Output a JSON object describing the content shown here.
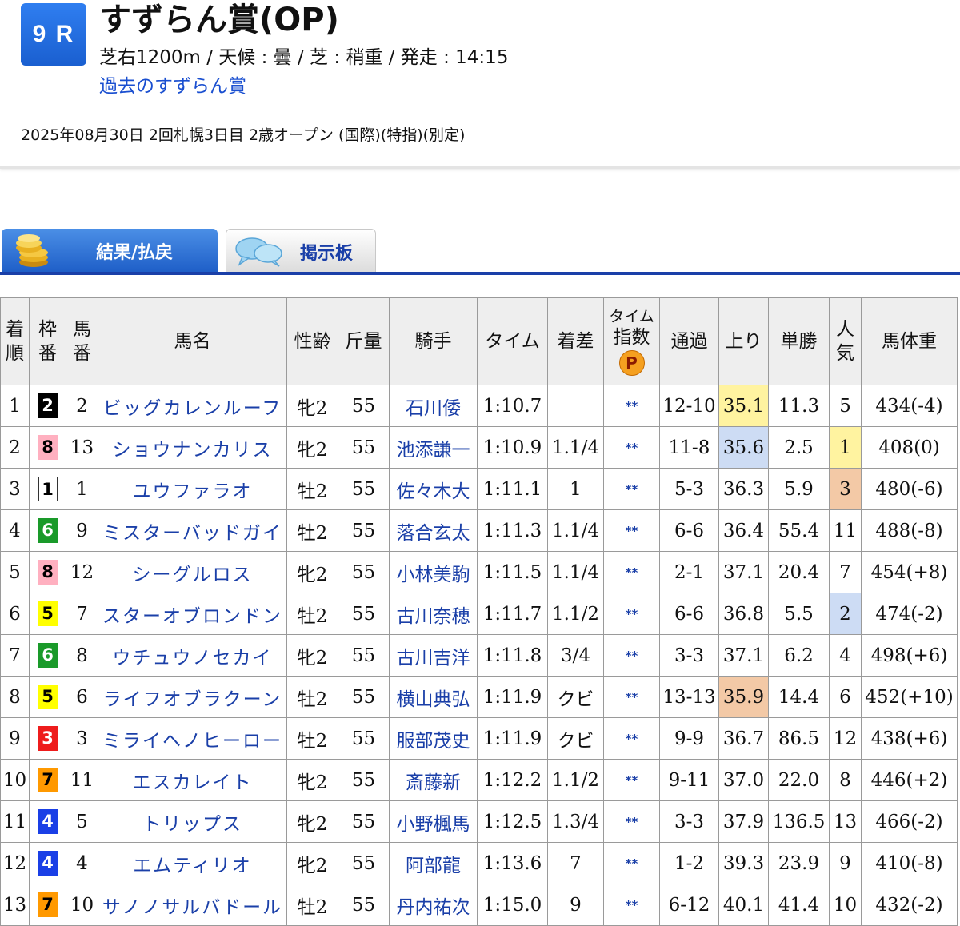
{
  "race": {
    "number": "9 R",
    "title": "すずらん賞(OP)",
    "info": "芝右1200m /  天候 : 曇 /  芝 : 稍重   /   発走 : 14:15",
    "past_link": "過去のすずらん賞",
    "date_line": "2025年08月30日 2回札幌3日目 2歳オープン  (国際)(特指)(別定)"
  },
  "tabs": {
    "results": "結果/払戻",
    "board": "掲示板"
  },
  "table": {
    "headers": {
      "rank": "着順",
      "waku": "枠番",
      "umaban": "馬番",
      "horse": "馬名",
      "sex_age": "性齢",
      "kinryo": "斤量",
      "jockey": "騎手",
      "time": "タイム",
      "margin": "着差",
      "time_index_top": "タイム",
      "time_index_bottom": "指数",
      "time_index_badge": "P",
      "passing": "通過",
      "last3f": "上り",
      "odds": "単勝",
      "popularity": "人気",
      "weight": "馬体重"
    },
    "rows": [
      {
        "rank": "1",
        "waku": "2",
        "umaban": "2",
        "horse": "ビッグカレンルーフ",
        "sex_age": "牝2",
        "kinryo": "55",
        "jockey": "石川倭",
        "time": "1:10.7",
        "margin": "",
        "index": "**",
        "passing": "12-10",
        "last3f": "35.1",
        "odds": "11.3",
        "pop": "5",
        "weight": "434(-4)"
      },
      {
        "rank": "2",
        "waku": "8",
        "umaban": "13",
        "horse": "ショウナンカリス",
        "sex_age": "牝2",
        "kinryo": "55",
        "jockey": "池添謙一",
        "time": "1:10.9",
        "margin": "1.1/4",
        "index": "**",
        "passing": "11-8",
        "last3f": "35.6",
        "odds": "2.5",
        "pop": "1",
        "weight": "408(0)"
      },
      {
        "rank": "3",
        "waku": "1",
        "umaban": "1",
        "horse": "ユウファラオ",
        "sex_age": "牡2",
        "kinryo": "55",
        "jockey": "佐々木大",
        "time": "1:11.1",
        "margin": "1",
        "index": "**",
        "passing": "5-3",
        "last3f": "36.3",
        "odds": "5.9",
        "pop": "3",
        "weight": "480(-6)"
      },
      {
        "rank": "4",
        "waku": "6",
        "umaban": "9",
        "horse": "ミスターバッドガイ",
        "sex_age": "牡2",
        "kinryo": "55",
        "jockey": "落合玄太",
        "time": "1:11.3",
        "margin": "1.1/4",
        "index": "**",
        "passing": "6-6",
        "last3f": "36.4",
        "odds": "55.4",
        "pop": "11",
        "weight": "488(-8)"
      },
      {
        "rank": "5",
        "waku": "8",
        "umaban": "12",
        "horse": "シーグルロス",
        "sex_age": "牝2",
        "kinryo": "55",
        "jockey": "小林美駒",
        "time": "1:11.5",
        "margin": "1.1/4",
        "index": "**",
        "passing": "2-1",
        "last3f": "37.1",
        "odds": "20.4",
        "pop": "7",
        "weight": "454(+8)"
      },
      {
        "rank": "6",
        "waku": "5",
        "umaban": "7",
        "horse": "スターオブロンドン",
        "sex_age": "牡2",
        "kinryo": "55",
        "jockey": "古川奈穂",
        "time": "1:11.7",
        "margin": "1.1/2",
        "index": "**",
        "passing": "6-6",
        "last3f": "36.8",
        "odds": "5.5",
        "pop": "2",
        "weight": "474(-2)"
      },
      {
        "rank": "7",
        "waku": "6",
        "umaban": "8",
        "horse": "ウチュウノセカイ",
        "sex_age": "牝2",
        "kinryo": "55",
        "jockey": "古川吉洋",
        "time": "1:11.8",
        "margin": "3/4",
        "index": "**",
        "passing": "3-3",
        "last3f": "37.1",
        "odds": "6.2",
        "pop": "4",
        "weight": "498(+6)"
      },
      {
        "rank": "8",
        "waku": "5",
        "umaban": "6",
        "horse": "ライフオブラクーン",
        "sex_age": "牡2",
        "kinryo": "55",
        "jockey": "横山典弘",
        "time": "1:11.9",
        "margin": "クビ",
        "index": "**",
        "passing": "13-13",
        "last3f": "35.9",
        "odds": "14.4",
        "pop": "6",
        "weight": "452(+10)"
      },
      {
        "rank": "9",
        "waku": "3",
        "umaban": "3",
        "horse": "ミライヘノヒーロー",
        "sex_age": "牡2",
        "kinryo": "55",
        "jockey": "服部茂史",
        "time": "1:11.9",
        "margin": "クビ",
        "index": "**",
        "passing": "9-9",
        "last3f": "36.7",
        "odds": "86.5",
        "pop": "12",
        "weight": "438(+6)"
      },
      {
        "rank": "10",
        "waku": "7",
        "umaban": "11",
        "horse": "エスカレイト",
        "sex_age": "牝2",
        "kinryo": "55",
        "jockey": "斎藤新",
        "time": "1:12.2",
        "margin": "1.1/2",
        "index": "**",
        "passing": "9-11",
        "last3f": "37.0",
        "odds": "22.0",
        "pop": "8",
        "weight": "446(+2)"
      },
      {
        "rank": "11",
        "waku": "4",
        "umaban": "5",
        "horse": "トリップス",
        "sex_age": "牝2",
        "kinryo": "55",
        "jockey": "小野楓馬",
        "time": "1:12.5",
        "margin": "1.3/4",
        "index": "**",
        "passing": "3-3",
        "last3f": "37.9",
        "odds": "136.5",
        "pop": "13",
        "weight": "466(-2)"
      },
      {
        "rank": "12",
        "waku": "4",
        "umaban": "4",
        "horse": "エムティリオ",
        "sex_age": "牝2",
        "kinryo": "55",
        "jockey": "阿部龍",
        "time": "1:13.6",
        "margin": "7",
        "index": "**",
        "passing": "1-2",
        "last3f": "39.3",
        "odds": "23.9",
        "pop": "9",
        "weight": "410(-8)"
      },
      {
        "rank": "13",
        "waku": "7",
        "umaban": "10",
        "horse": "サノノサルバドール",
        "sex_age": "牡2",
        "kinryo": "55",
        "jockey": "丹内祐次",
        "time": "1:15.0",
        "margin": "9",
        "index": "**",
        "passing": "6-12",
        "last3f": "40.1",
        "odds": "41.4",
        "pop": "10",
        "weight": "432(-2)"
      }
    ],
    "highlights": {
      "last3f": {
        "0": "yellow",
        "1": "blue",
        "7": "orange"
      },
      "pop": {
        "1": "yellow",
        "5": "blue",
        "2": "orange"
      }
    }
  },
  "colors": {
    "accent": "#1a3fa8",
    "link": "#1a4fd0",
    "highlight_1st": "#fff3a0",
    "highlight_2nd": "#cddcf4",
    "highlight_3rd": "#f3c9a6"
  }
}
